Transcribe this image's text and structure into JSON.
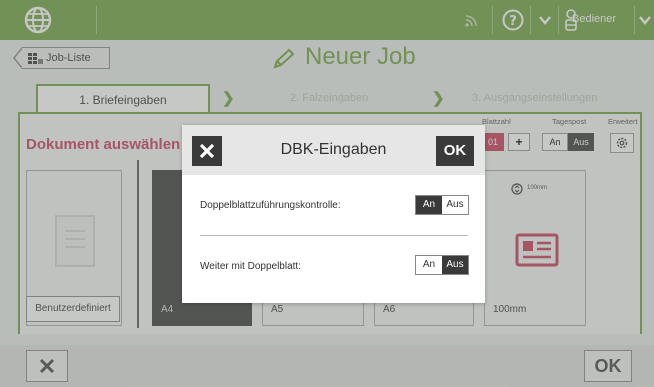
{
  "topbar": {
    "user_label": "Bediener",
    "icons": [
      "globe-icon",
      "signal-icon",
      "help-icon",
      "chevron-down-icon",
      "user-icon",
      "chevron-down-icon"
    ]
  },
  "header": {
    "back_label": "Job-Liste",
    "title": "Neuer Job"
  },
  "tabs": [
    {
      "label": "1. Briefeingaben"
    },
    {
      "label": "2. Falzeingaben"
    },
    {
      "label": "3. Ausgangseinstellungen"
    }
  ],
  "main": {
    "doc_title": "Dokument auswählen",
    "blattzahl_label": "Blattzahl",
    "blattzahl_value": "01",
    "tagespost_label": "Tagespost",
    "tagespost_on": "An",
    "tagespost_off": "Aus",
    "erweitert_label": "Erweitert",
    "custom_label": "Benutzerdefiniert",
    "cards": [
      {
        "label": "A4"
      },
      {
        "label": "A5"
      },
      {
        "label": "A6"
      },
      {
        "label": "100mm",
        "sub": "100mm"
      }
    ]
  },
  "dialog": {
    "title": "DBK-Eingaben",
    "ok_label": "OK",
    "rows": [
      {
        "label": "Doppelblattzuführungskontrolle:",
        "on": "An",
        "off": "Aus",
        "selected": "An"
      },
      {
        "label": "Weiter mit Doppelblatt:",
        "on": "An",
        "off": "Aus",
        "selected": "Aus"
      }
    ]
  },
  "bottom": {
    "ok_label": "OK"
  },
  "colors": {
    "accent": "#6da03f",
    "title_red": "#c83a55",
    "dark": "#3a3a3a"
  }
}
